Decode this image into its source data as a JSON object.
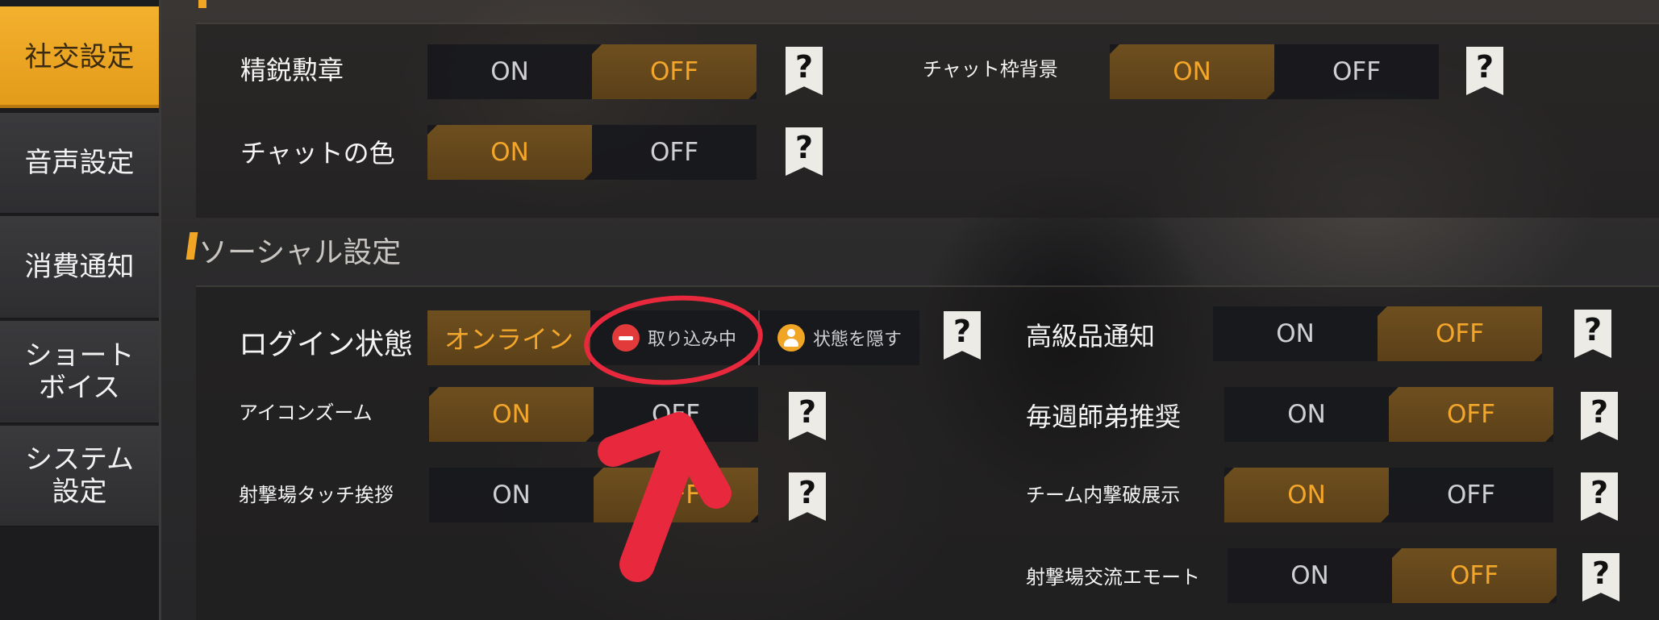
{
  "sidebar": {
    "items": [
      {
        "label": "社交設定"
      },
      {
        "label": "音声設定"
      },
      {
        "label": "消費通知"
      },
      {
        "label_line1": "ショート",
        "label_line2": "ボイス"
      },
      {
        "label_line1": "システム",
        "label_line2": "設定"
      }
    ]
  },
  "sections": {
    "social_title": "ソーシャル設定"
  },
  "toggle_labels": {
    "on": "ON",
    "off": "OFF"
  },
  "help_glyph": "?",
  "settings_top": {
    "elite_medal": {
      "label": "精鋭勲章",
      "value": "OFF"
    },
    "chat_color": {
      "label": "チャットの色",
      "value": "ON"
    },
    "chat_frame_bg": {
      "label": "チャット枠背景",
      "value": "ON"
    }
  },
  "settings_social": {
    "login_status": {
      "label": "ログイン状態",
      "options": [
        "オンライン",
        "取り込み中",
        "状態を隠す"
      ],
      "selected": "オンライン"
    },
    "icon_zoom": {
      "label": "アイコンズーム",
      "value": "ON"
    },
    "range_touch_greeting": {
      "label": "射撃場タッチ挨拶",
      "value": "OFF"
    },
    "luxury_notice": {
      "label": "高級品通知",
      "value": "OFF"
    },
    "weekly_mentor": {
      "label": "毎週師弟推奨",
      "value": "OFF"
    },
    "team_kill_display": {
      "label": "チーム内撃破展示",
      "value": "ON"
    },
    "range_emote": {
      "label": "射撃場交流エモート",
      "value": "OFF"
    }
  },
  "annotation": {
    "color": "#e8283c"
  }
}
